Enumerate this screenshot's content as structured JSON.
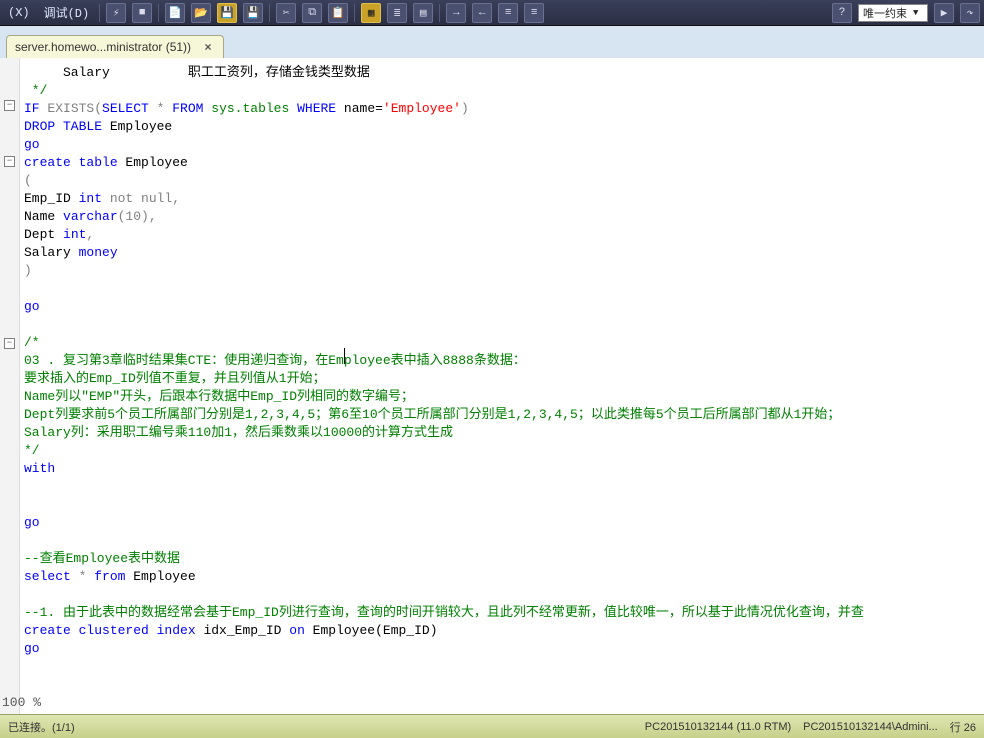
{
  "toolbar": {
    "menu_window": "(X)",
    "menu_debug": "调试(D)",
    "combo_value": "唯一约束",
    "icons": [
      "connect",
      "stop",
      "new",
      "open",
      "save",
      "saveall",
      "sep",
      "cut",
      "copy",
      "paste",
      "sep",
      "table",
      "grid",
      "sort",
      "sep",
      "indent",
      "outdent",
      "sep",
      "play",
      "execute",
      "sep",
      "comment",
      "uncomment"
    ]
  },
  "tab": {
    "title": "server.homewo...ministrator (51))",
    "close": "×"
  },
  "code": {
    "l01a": "     Salary",
    "l01b": "          职工工资列，存储金钱类型数据",
    "l02": " */",
    "l03_if": "IF",
    "l03_exists": " EXISTS(",
    "l03_select": "SELECT",
    "l03_star": " * ",
    "l03_from": "FROM",
    "l03_sys": " sys.tables ",
    "l03_where": "WHERE",
    "l03_nameeq": " name=",
    "l03_lit": "'Employee'",
    "l03_end": ")",
    "l04_drop": "DROP TABLE",
    "l04_emp": " Employee",
    "l05": "go",
    "l06_ct": "create table",
    "l06_emp": " Employee",
    "l07": "(",
    "l08_col": "Emp_ID ",
    "l08_type": "int",
    "l08_nn": " not null,",
    "l09_col": "Name ",
    "l09_type": "varchar",
    "l09_len": "(10),",
    "l10_col": "Dept ",
    "l10_type": "int",
    "l10_end": ",",
    "l11_col": "Salary ",
    "l11_type": "money",
    "l12": ")",
    "l14": "go",
    "c_block_open": "/*",
    "c1": "03 . 复习第3章临时结果集CTE：使用递归查询，在Employee表中插入8888条数据：",
    "c2": "要求插入的Emp_ID列值不重复，并且列值从1开始；",
    "c3": "Name列以\"EMP\"开头，后跟本行数据中Emp_ID列相同的数字编号；",
    "c4": "Dept列要求前5个员工所属部门分别是1,2,3,4,5；第6至10个员工所属部门分别是1,2,3,4,5；以此类推每5个员工后所属部门都从1开始；",
    "c5": "Salary列：采用职工编号乘110加1，然后乘数乘以10000的计算方式生成",
    "c_block_close": "*/",
    "l_with": "with",
    "l_go2": "go",
    "c6": "--查看Employee表中数据",
    "sel_kw": "select",
    "sel_star": " * ",
    "sel_from": "from",
    "sel_tbl": " Employee",
    "c7": "--1. 由于此表中的数据经常会基于Emp_ID列进行查询，查询的时间开销较大，且此列不经常更新，值比较唯一，所以基于此情况优化查询，并查",
    "idx_create": "create clustered index",
    "idx_name": " idx_Emp_ID ",
    "idx_on": "on",
    "idx_tbl": " Employee(Emp_ID)",
    "l_go3": "go"
  },
  "zoom": "100 %",
  "status": {
    "left": "已连接。(1/1)",
    "server": "PC201510132144 (11.0 RTM)",
    "user": "PC201510132144\\Admini...",
    "line_label": "行 26"
  }
}
